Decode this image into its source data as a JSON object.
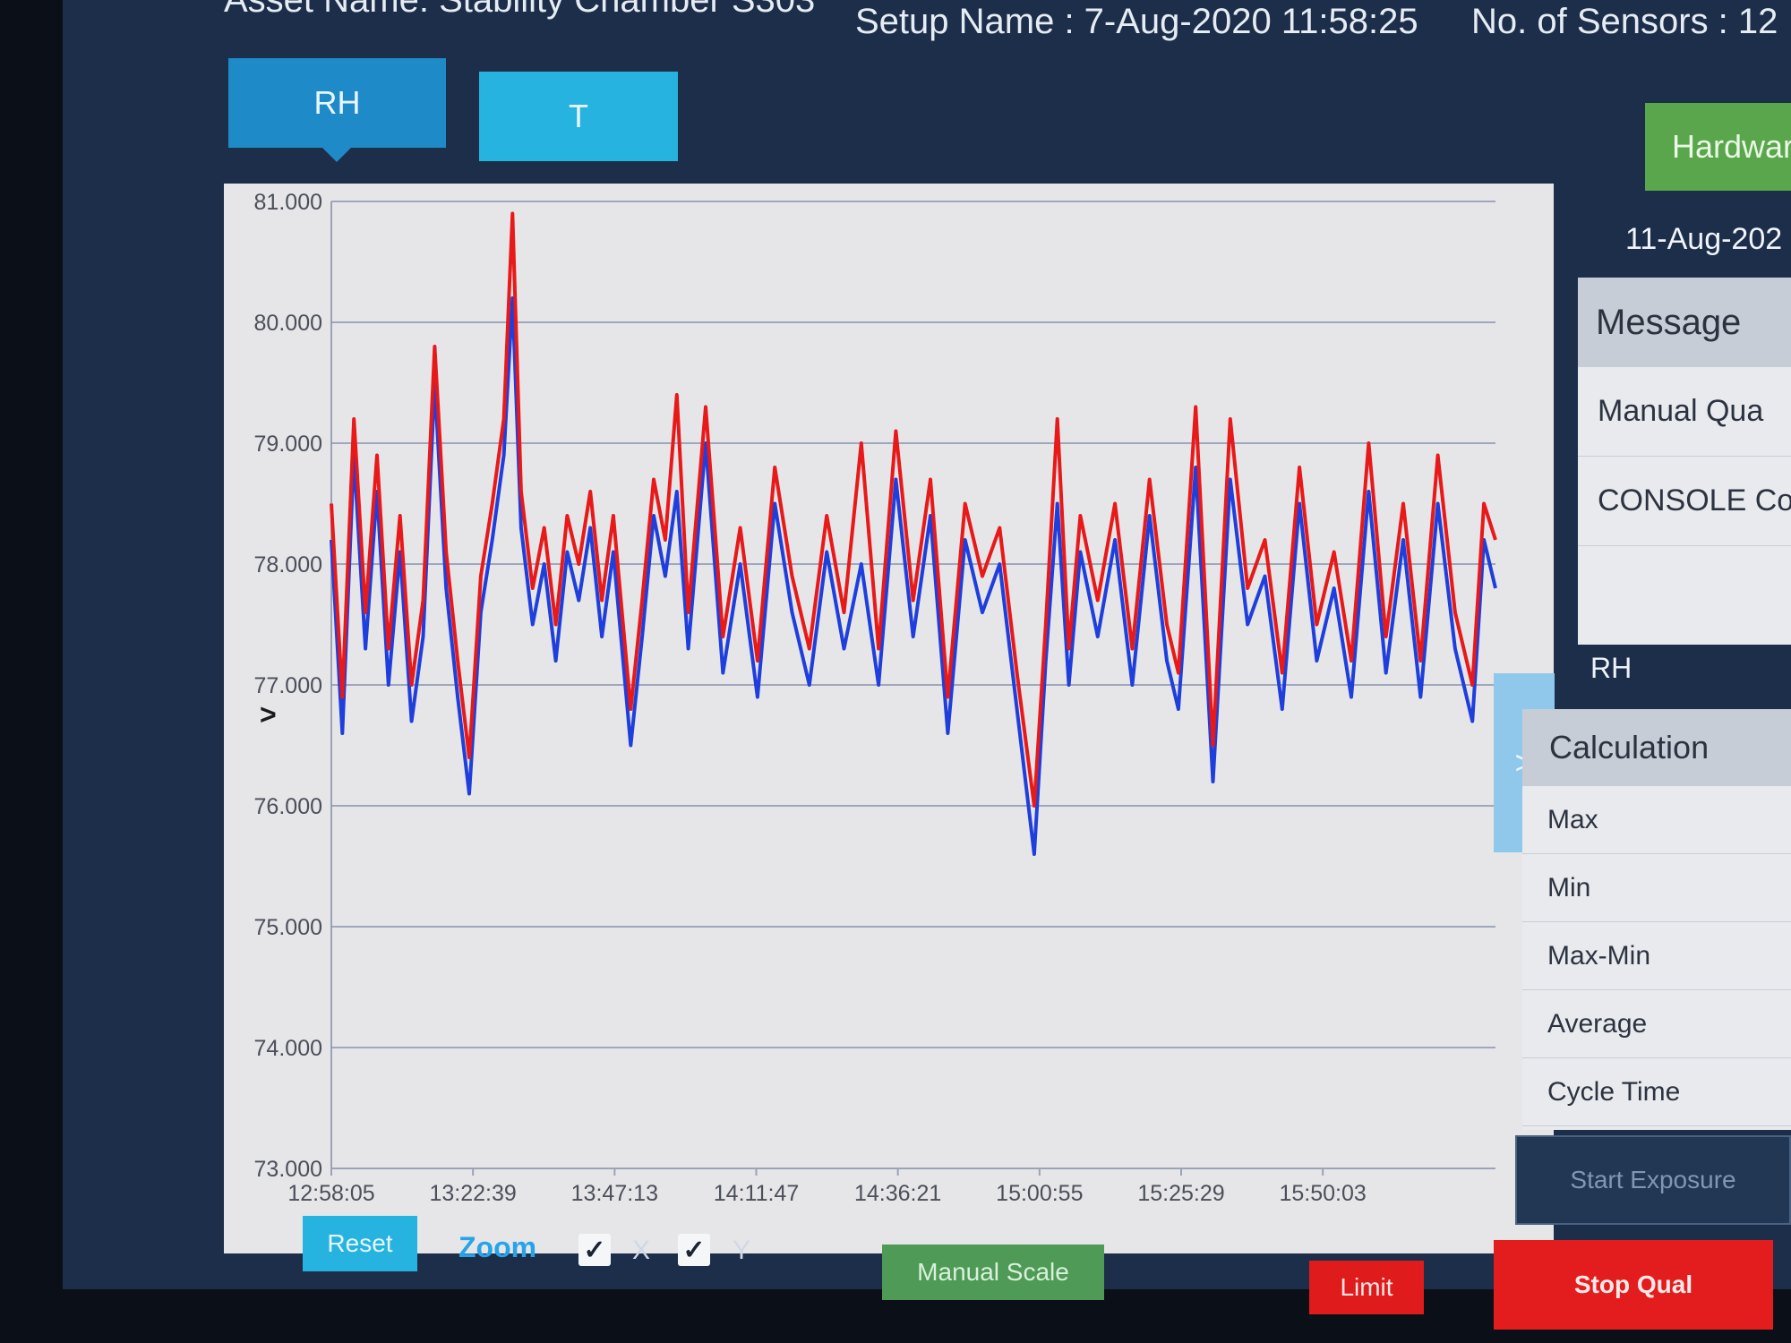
{
  "header": {
    "asset": "Asset Name: Stability Chamber S303",
    "setup": "Setup Name : 7-Aug-2020 11:58:25",
    "sensors": "No. of Sensors : 12"
  },
  "tabs": [
    {
      "label": "RH",
      "active": true
    },
    {
      "label": "T",
      "active": false
    }
  ],
  "colors": {
    "background": "#1d2e4a",
    "plot_background": "#e6e6e9",
    "tab_active": "#1f8ac8",
    "tab_inactive": "#27b3e0",
    "series_red": "#e81919",
    "series_blue": "#1f3fdc",
    "limit_button": "#e01b1b",
    "stop_button": "#e31d1d",
    "hardware_button": "#5aa64c",
    "manual_scale_button": "#4e9a56"
  },
  "chart_data": {
    "type": "line",
    "title": "",
    "xlabel": "",
    "ylabel": "",
    "ylim": [
      73.0,
      81.0
    ],
    "grid": true,
    "y_ticks": [
      "81.000",
      "80.000",
      "79.000",
      "78.000",
      "77.000",
      "76.000",
      "75.000",
      "74.000",
      "73.000"
    ],
    "x_tick_labels": [
      "12:58:05",
      "13:22:39",
      "13:47:13",
      "14:11:47",
      "14:36:21",
      "15:00:55",
      "15:25:29",
      "15:50:03"
    ],
    "x_range": [
      "12:58:05",
      "16:20:00"
    ],
    "series": [
      {
        "color": "#1f3fdc",
        "points": [
          [
            "12:58:05",
            78.2
          ],
          [
            "13:00:00",
            76.6
          ],
          [
            "13:02:00",
            78.9
          ],
          [
            "13:04:00",
            77.3
          ],
          [
            "13:06:00",
            78.6
          ],
          [
            "13:08:00",
            77.0
          ],
          [
            "13:10:00",
            78.1
          ],
          [
            "13:12:00",
            76.7
          ],
          [
            "13:14:00",
            77.4
          ],
          [
            "13:16:00",
            79.5
          ],
          [
            "13:18:00",
            77.8
          ],
          [
            "13:20:00",
            76.9
          ],
          [
            "13:22:00",
            76.1
          ],
          [
            "13:24:00",
            77.6
          ],
          [
            "13:26:00",
            78.2
          ],
          [
            "13:28:00",
            78.9
          ],
          [
            "13:29:30",
            80.2
          ],
          [
            "13:31:00",
            78.3
          ],
          [
            "13:33:00",
            77.5
          ],
          [
            "13:35:00",
            78.0
          ],
          [
            "13:37:00",
            77.2
          ],
          [
            "13:39:00",
            78.1
          ],
          [
            "13:41:00",
            77.7
          ],
          [
            "13:43:00",
            78.3
          ],
          [
            "13:45:00",
            77.4
          ],
          [
            "13:47:00",
            78.1
          ],
          [
            "13:50:00",
            76.5
          ],
          [
            "13:52:00",
            77.4
          ],
          [
            "13:54:00",
            78.4
          ],
          [
            "13:56:00",
            77.9
          ],
          [
            "13:58:00",
            78.6
          ],
          [
            "14:00:00",
            77.3
          ],
          [
            "14:03:00",
            79.0
          ],
          [
            "14:06:00",
            77.1
          ],
          [
            "14:09:00",
            78.0
          ],
          [
            "14:12:00",
            76.9
          ],
          [
            "14:15:00",
            78.5
          ],
          [
            "14:18:00",
            77.6
          ],
          [
            "14:21:00",
            77.0
          ],
          [
            "14:24:00",
            78.1
          ],
          [
            "14:27:00",
            77.3
          ],
          [
            "14:30:00",
            78.0
          ],
          [
            "14:33:00",
            77.0
          ],
          [
            "14:36:00",
            78.7
          ],
          [
            "14:39:00",
            77.4
          ],
          [
            "14:42:00",
            78.4
          ],
          [
            "14:45:00",
            76.6
          ],
          [
            "14:48:00",
            78.2
          ],
          [
            "14:51:00",
            77.6
          ],
          [
            "14:54:00",
            78.0
          ],
          [
            "14:57:00",
            76.8
          ],
          [
            "15:00:00",
            75.6
          ],
          [
            "15:02:00",
            77.2
          ],
          [
            "15:04:00",
            78.5
          ],
          [
            "15:06:00",
            77.0
          ],
          [
            "15:08:00",
            78.1
          ],
          [
            "15:11:00",
            77.4
          ],
          [
            "15:14:00",
            78.2
          ],
          [
            "15:17:00",
            77.0
          ],
          [
            "15:20:00",
            78.4
          ],
          [
            "15:23:00",
            77.2
          ],
          [
            "15:25:00",
            76.8
          ],
          [
            "15:28:00",
            78.8
          ],
          [
            "15:31:00",
            76.2
          ],
          [
            "15:34:00",
            78.7
          ],
          [
            "15:37:00",
            77.5
          ],
          [
            "15:40:00",
            77.9
          ],
          [
            "15:43:00",
            76.8
          ],
          [
            "15:46:00",
            78.5
          ],
          [
            "15:49:00",
            77.2
          ],
          [
            "15:52:00",
            77.8
          ],
          [
            "15:55:00",
            76.9
          ],
          [
            "15:58:00",
            78.6
          ],
          [
            "16:01:00",
            77.1
          ],
          [
            "16:04:00",
            78.2
          ],
          [
            "16:07:00",
            76.9
          ],
          [
            "16:10:00",
            78.5
          ],
          [
            "16:13:00",
            77.3
          ],
          [
            "16:16:00",
            76.7
          ],
          [
            "16:18:00",
            78.2
          ],
          [
            "16:20:00",
            77.8
          ]
        ]
      },
      {
        "color": "#e81919",
        "points": [
          [
            "12:58:05",
            78.5
          ],
          [
            "13:00:00",
            76.9
          ],
          [
            "13:02:00",
            79.2
          ],
          [
            "13:04:00",
            77.6
          ],
          [
            "13:06:00",
            78.9
          ],
          [
            "13:08:00",
            77.3
          ],
          [
            "13:10:00",
            78.4
          ],
          [
            "13:12:00",
            77.0
          ],
          [
            "13:14:00",
            77.7
          ],
          [
            "13:16:00",
            79.8
          ],
          [
            "13:18:00",
            78.1
          ],
          [
            "13:20:00",
            77.2
          ],
          [
            "13:22:00",
            76.4
          ],
          [
            "13:24:00",
            77.9
          ],
          [
            "13:26:00",
            78.5
          ],
          [
            "13:28:00",
            79.2
          ],
          [
            "13:29:30",
            80.9
          ],
          [
            "13:31:00",
            78.6
          ],
          [
            "13:33:00",
            77.8
          ],
          [
            "13:35:00",
            78.3
          ],
          [
            "13:37:00",
            77.5
          ],
          [
            "13:39:00",
            78.4
          ],
          [
            "13:41:00",
            78.0
          ],
          [
            "13:43:00",
            78.6
          ],
          [
            "13:45:00",
            77.7
          ],
          [
            "13:47:00",
            78.4
          ],
          [
            "13:50:00",
            76.8
          ],
          [
            "13:52:00",
            77.7
          ],
          [
            "13:54:00",
            78.7
          ],
          [
            "13:56:00",
            78.2
          ],
          [
            "13:58:00",
            79.4
          ],
          [
            "14:00:00",
            77.6
          ],
          [
            "14:03:00",
            79.3
          ],
          [
            "14:06:00",
            77.4
          ],
          [
            "14:09:00",
            78.3
          ],
          [
            "14:12:00",
            77.2
          ],
          [
            "14:15:00",
            78.8
          ],
          [
            "14:18:00",
            77.9
          ],
          [
            "14:21:00",
            77.3
          ],
          [
            "14:24:00",
            78.4
          ],
          [
            "14:27:00",
            77.6
          ],
          [
            "14:30:00",
            79.0
          ],
          [
            "14:33:00",
            77.3
          ],
          [
            "14:36:00",
            79.1
          ],
          [
            "14:39:00",
            77.7
          ],
          [
            "14:42:00",
            78.7
          ],
          [
            "14:45:00",
            76.9
          ],
          [
            "14:48:00",
            78.5
          ],
          [
            "14:51:00",
            77.9
          ],
          [
            "14:54:00",
            78.3
          ],
          [
            "14:57:00",
            77.1
          ],
          [
            "15:00:00",
            76.0
          ],
          [
            "15:02:00",
            77.5
          ],
          [
            "15:04:00",
            79.2
          ],
          [
            "15:06:00",
            77.3
          ],
          [
            "15:08:00",
            78.4
          ],
          [
            "15:11:00",
            77.7
          ],
          [
            "15:14:00",
            78.5
          ],
          [
            "15:17:00",
            77.3
          ],
          [
            "15:20:00",
            78.7
          ],
          [
            "15:23:00",
            77.5
          ],
          [
            "15:25:00",
            77.1
          ],
          [
            "15:28:00",
            79.3
          ],
          [
            "15:31:00",
            76.5
          ],
          [
            "15:34:00",
            79.2
          ],
          [
            "15:37:00",
            77.8
          ],
          [
            "15:40:00",
            78.2
          ],
          [
            "15:43:00",
            77.1
          ],
          [
            "15:46:00",
            78.8
          ],
          [
            "15:49:00",
            77.5
          ],
          [
            "15:52:00",
            78.1
          ],
          [
            "15:55:00",
            77.2
          ],
          [
            "15:58:00",
            79.0
          ],
          [
            "16:01:00",
            77.4
          ],
          [
            "16:04:00",
            78.5
          ],
          [
            "16:07:00",
            77.2
          ],
          [
            "16:10:00",
            78.9
          ],
          [
            "16:13:00",
            77.6
          ],
          [
            "16:16:00",
            77.0
          ],
          [
            "16:18:00",
            78.5
          ],
          [
            "16:20:00",
            78.2
          ]
        ]
      }
    ]
  },
  "controls": {
    "collapse_arrow": ">",
    "reset": "Reset",
    "zoom": "Zoom",
    "zoom_x_label": "X",
    "zoom_y_label": "Y",
    "zoom_x_checked": true,
    "zoom_y_checked": true,
    "check_glyph": "✓",
    "manual_scale": "Manual Scale",
    "limit": "Limit"
  },
  "side": {
    "hardware": "Hardwar",
    "date": "11-Aug-202",
    "messages_header": "Message",
    "messages": [
      "Manual Qua",
      "CONSOLE Co"
    ],
    "section_label": "RH",
    "toggle": ">",
    "calc_header": "Calculation",
    "calc_rows": [
      "Max",
      "Min",
      "Max-Min",
      "Average",
      "Cycle Time"
    ],
    "start_exposure": "Start Exposure",
    "stop_qual": "Stop Qual"
  }
}
